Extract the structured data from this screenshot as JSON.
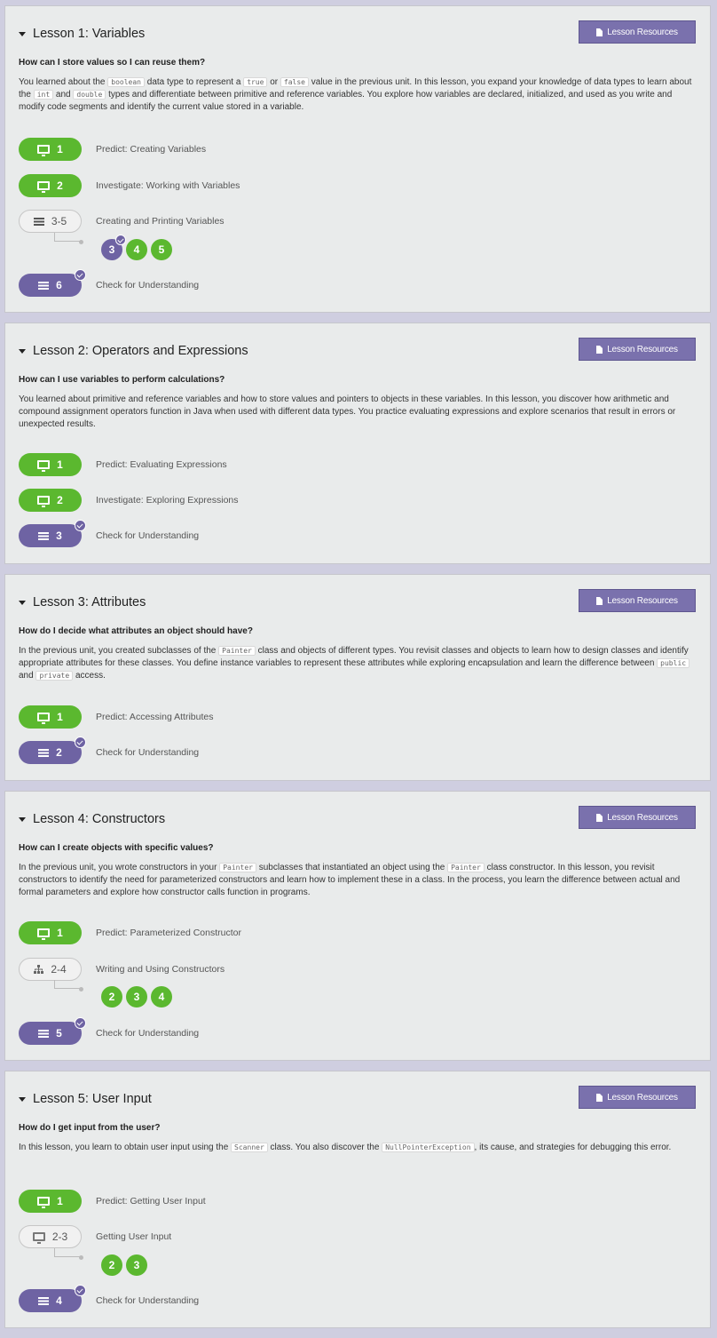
{
  "resources_label": "Lesson Resources",
  "lessons": [
    {
      "title": "Lesson 1: Variables",
      "question": "How can I store values so I can reuse them?",
      "desc": [
        {
          "t": "You learned about the "
        },
        {
          "c": "boolean"
        },
        {
          "t": " data type to represent a "
        },
        {
          "c": "true"
        },
        {
          "t": " or "
        },
        {
          "c": "false"
        },
        {
          "t": " value in the previous unit. In this lesson, you expand your knowledge of data types to learn about the "
        },
        {
          "c": "int"
        },
        {
          "t": " and "
        },
        {
          "c": "double"
        },
        {
          "t": " types and differentiate between primitive and reference variables. You explore how variables are declared, initialized, and used as you write and modify code segments and identify the current value stored in a variable."
        }
      ],
      "rows": [
        {
          "num": "1",
          "label": "Predict: Creating Variables"
        },
        {
          "num": "2",
          "label": "Investigate: Working with Variables"
        },
        {
          "num": "3-5",
          "label": "Creating and Printing Variables"
        },
        {
          "num": "6",
          "label": "Check for Understanding"
        }
      ],
      "bubbles": [
        "3",
        "4",
        "5"
      ]
    },
    {
      "title": "Lesson 2: Operators and Expressions",
      "question": "How can I use variables to perform calculations?",
      "desc": [
        {
          "t": "You learned about primitive and reference variables and how to store values and pointers to objects in these variables. In this lesson, you discover how arithmetic and compound assignment operators function in Java when used with different data types. You practice evaluating expressions and explore scenarios that result in errors or unexpected results."
        }
      ],
      "rows": [
        {
          "num": "1",
          "label": "Predict: Evaluating Expressions"
        },
        {
          "num": "2",
          "label": "Investigate: Exploring Expressions"
        },
        {
          "num": "3",
          "label": "Check for Understanding"
        }
      ]
    },
    {
      "title": "Lesson 3: Attributes",
      "question": "How do I decide what attributes an object should have?",
      "desc": [
        {
          "t": "In the previous unit, you created subclasses of the "
        },
        {
          "c": "Painter"
        },
        {
          "t": " class and objects of different types. You revisit classes and objects to learn how to design classes and identify appropriate attributes for these classes. You define instance variables to represent these attributes while exploring encapsulation and learn the difference between "
        },
        {
          "c": "public"
        },
        {
          "t": " and "
        },
        {
          "c": "private"
        },
        {
          "t": " access."
        }
      ],
      "rows": [
        {
          "num": "1",
          "label": "Predict: Accessing Attributes"
        },
        {
          "num": "2",
          "label": "Check for Understanding"
        }
      ]
    },
    {
      "title": "Lesson 4: Constructors",
      "question": "How can I create objects with specific values?",
      "desc": [
        {
          "t": "In the previous unit, you wrote constructors in your "
        },
        {
          "c": "Painter"
        },
        {
          "t": " subclasses that instantiated an object using the "
        },
        {
          "c": "Painter"
        },
        {
          "t": " class constructor. In this lesson, you revisit constructors to identify the need for parameterized constructors and learn how to implement these in a class. In the process, you learn the difference between actual and formal parameters and explore how constructor calls function in programs."
        }
      ],
      "rows": [
        {
          "num": "1",
          "label": "Predict: Parameterized Constructor"
        },
        {
          "num": "2-4",
          "label": "Writing and Using Constructors"
        },
        {
          "num": "5",
          "label": "Check for Understanding"
        }
      ],
      "bubbles": [
        "2",
        "3",
        "4"
      ]
    },
    {
      "title": "Lesson 5: User Input",
      "question": "How do I get input from the user?",
      "desc": [
        {
          "t": "In this lesson, you learn to obtain user input using the "
        },
        {
          "c": "Scanner"
        },
        {
          "t": " class. You also discover the "
        },
        {
          "c": "NullPointerException"
        },
        {
          "t": ", its cause, and strategies for debugging this error."
        }
      ],
      "rows": [
        {
          "num": "1",
          "label": "Predict: Getting User Input"
        },
        {
          "num": "2-3",
          "label": "Getting User Input"
        },
        {
          "num": "4",
          "label": "Check for Understanding"
        }
      ],
      "bubbles": [
        "2",
        "3"
      ]
    }
  ]
}
